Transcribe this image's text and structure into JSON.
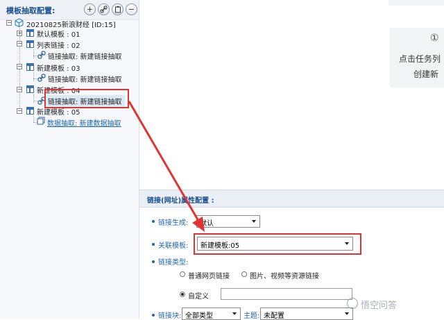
{
  "left_panel": {
    "title": "模板抽取配置:",
    "toolbar": [
      "add-icon",
      "link-icon",
      "clipboard-icon",
      "remove-icon"
    ],
    "tree": {
      "root_label": "20210825新浪财经 [ID:15]",
      "items": [
        {
          "label": "默认模板 : 01",
          "depth": 1,
          "expandable": true,
          "type": "template"
        },
        {
          "label": "列表链接 : 02",
          "depth": 1,
          "expandable": true,
          "type": "template"
        },
        {
          "label": "链接抽取: 新建链接抽取",
          "depth": 2,
          "type": "link"
        },
        {
          "label": "新建模板 : 03",
          "depth": 1,
          "expandable": true,
          "type": "template"
        },
        {
          "label": "链接抽取: 新建链接抽取",
          "depth": 2,
          "type": "link"
        },
        {
          "label": "新建模板 : 04",
          "depth": 1,
          "expandable": true,
          "type": "template"
        },
        {
          "label": "链接抽取: 新建链接抽取",
          "depth": 2,
          "type": "link",
          "highlighted": true
        },
        {
          "label": "新建模板 : 05",
          "depth": 1,
          "expandable": true,
          "type": "template"
        },
        {
          "label": "数据抽取: 新建数据抽取",
          "depth": 2,
          "type": "data",
          "link_style": true
        }
      ]
    }
  },
  "right_tip": {
    "circle_glyph": "①",
    "line1": "点击任务列",
    "line2": "创建新"
  },
  "properties": {
    "title": "链接(网址)属性配置 :",
    "link_gen_label": "链接生成:",
    "link_gen_value": "默认",
    "assoc_template_label": "关联模板:",
    "assoc_template_value": "新建模板:05",
    "link_type_label": "链接类型:",
    "radio_options": [
      {
        "label": "普通网页链接",
        "checked": false
      },
      {
        "label": "图片、视频等资源链接",
        "checked": false
      },
      {
        "label": "自定义",
        "checked": true
      }
    ],
    "custom_value": "",
    "link_block_label": "链接块:",
    "link_block_value": "全部类型",
    "theme_label": "主题:",
    "theme_value": "未配置"
  },
  "watermark": {
    "text": "悟空问答"
  },
  "colors": {
    "accent": "#1f66b3",
    "highlight_red": "#e03333"
  }
}
